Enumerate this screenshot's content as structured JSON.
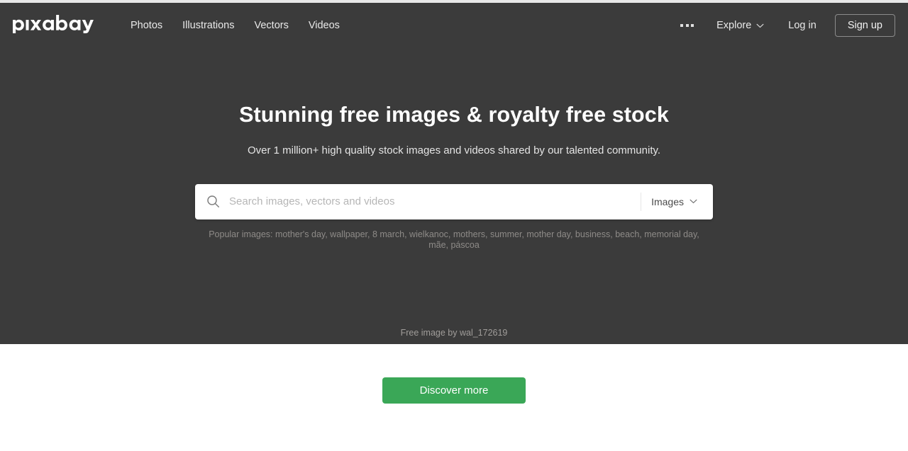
{
  "brand": {
    "logo_text": "pixabay",
    "accent_green": "#3aa757",
    "hero_background": "#3b3b3b"
  },
  "header": {
    "nav_items": [
      {
        "label": "Photos",
        "name": "nav-photos"
      },
      {
        "label": "Illustrations",
        "name": "nav-illustrations"
      },
      {
        "label": "Vectors",
        "name": "nav-vectors"
      },
      {
        "label": "Videos",
        "name": "nav-videos"
      }
    ],
    "more_menu_icon": "ellipsis-icon",
    "explore": {
      "label": "Explore",
      "chevron": "chevron-down-icon"
    },
    "login_label": "Log in",
    "signup_label": "Sign up"
  },
  "hero": {
    "title": "Stunning free images & royalty free stock",
    "subtitle": "Over 1 million+ high quality stock images and videos shared by our talented community.",
    "attribution": "Free image by wal_172619"
  },
  "search": {
    "icon": "search-icon",
    "placeholder": "Search images, vectors and videos",
    "value": "",
    "type_label": "Images",
    "type_chevron": "chevron-down-icon",
    "popular_text": "Popular images: mother's day, wallpaper, 8 march, wielkanoc, mothers, summer, mother day, business, beach, memorial day, mãe, páscoa",
    "popular_prefix": "Popular images:",
    "popular_terms": [
      "mother's day",
      "wallpaper",
      "8 march",
      "wielkanoc",
      "mothers",
      "summer",
      "mother day",
      "business",
      "beach",
      "memorial day",
      "mãe",
      "páscoa"
    ]
  },
  "main": {
    "discover_label": "Discover more"
  }
}
